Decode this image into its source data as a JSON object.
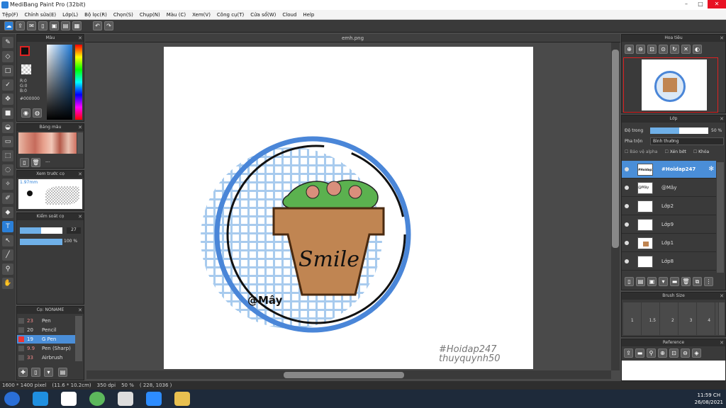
{
  "window": {
    "title": "MediBang Paint Pro (32bit)",
    "controls": [
      "–",
      "□",
      "✕"
    ]
  },
  "menu": [
    "Tệp(F)",
    "Chỉnh sửa(E)",
    "Lớp(L)",
    "Bộ lọc(R)",
    "Chọn(S)",
    "Chụp(N)",
    "Màu (C)",
    "Xem(V)",
    "Công cụ(T)",
    "Cửa sổ(W)",
    "Cloud",
    "Help"
  ],
  "document": {
    "tab": "emh.png"
  },
  "color_panel": {
    "title": "Màu",
    "r": "R:0",
    "g": "G:0",
    "b": "B:0",
    "hex": "#000000"
  },
  "palette_panel": {
    "title": "Bảng màu",
    "extra": "---"
  },
  "preview_panel": {
    "title": "Xem trước cọ",
    "size": "1.97mm"
  },
  "control_panel": {
    "title": "Kiểm soát cọ",
    "size": "27",
    "opacity": "100 %"
  },
  "brush_panel": {
    "title": "Cọ: NONAME",
    "items": [
      {
        "size": "23",
        "name": "Pen"
      },
      {
        "size": "20",
        "name": "Pencil"
      },
      {
        "size": "19",
        "name": "G Pen",
        "selected": true
      },
      {
        "size": "9.9",
        "name": "Pen (Sharp)"
      },
      {
        "size": "33",
        "name": "Airbrush"
      }
    ]
  },
  "navigator_panel": {
    "title": "Hoa tiêu"
  },
  "layer_panel": {
    "title": "Lớp",
    "opacity_label": "Độ trong",
    "opacity_value": "50 %",
    "blend_label": "Pha trộn",
    "blend_value": "Bình thường",
    "options": [
      "Bảo vệ alpha",
      "Xén bớt",
      "Khóa"
    ],
    "layers": [
      {
        "name": "#Hoidap247",
        "thumb": "#Hoidap247",
        "selected": true
      },
      {
        "name": "@Mây",
        "thumb": "@Mây"
      },
      {
        "name": "Lớp2"
      },
      {
        "name": "Lớp9"
      },
      {
        "name": "Lớp1"
      },
      {
        "name": "Lớp8"
      }
    ]
  },
  "brushsize_panel": {
    "title": "Brush Size",
    "sizes": [
      "1",
      "1.5",
      "2",
      "3",
      "4"
    ]
  },
  "reference_panel": {
    "title": "Reference"
  },
  "artwork": {
    "pot_text": "Smile",
    "signature": "@Mây",
    "watermark1": "#Hoidap247",
    "watermark2": "thuyquynh50"
  },
  "status": {
    "size": "1600 * 1400 pixel",
    "cm": "(11.6 * 10.2cm)",
    "dpi": "350 dpi",
    "zoom": "50 %",
    "coords": "( 228, 1036 )"
  },
  "taskbar": {
    "time": "11:59 CH",
    "date": "26/08/2021"
  },
  "colors": {
    "accent": "#2a7fd8",
    "pot": "#c08552",
    "grid": "#a8cbee",
    "ring": "#4a86d8"
  }
}
